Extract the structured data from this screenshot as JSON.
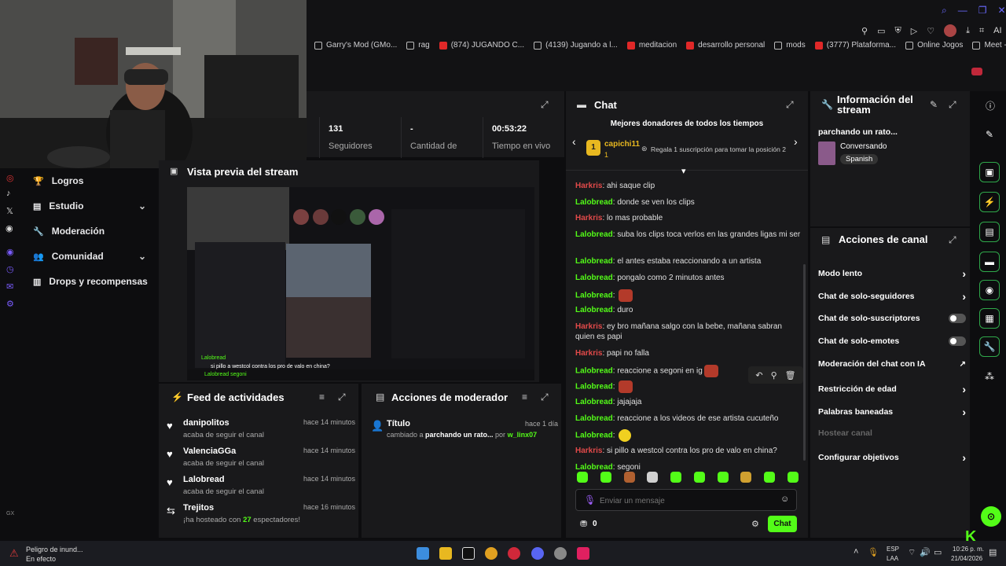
{
  "bookmarks": [
    {
      "label": "Garry's Mod (GMo...",
      "icon": "doc"
    },
    {
      "label": "rag",
      "icon": "doc"
    },
    {
      "label": "(874) JUGANDO C...",
      "icon": "youtube"
    },
    {
      "label": "(4139) Jugando a l...",
      "icon": "doc"
    },
    {
      "label": "meditacion",
      "icon": "youtube"
    },
    {
      "label": "desarrollo personal",
      "icon": "youtube"
    },
    {
      "label": "mods",
      "icon": "doc"
    },
    {
      "label": "(3777) Plataforma...",
      "icon": "youtube"
    },
    {
      "label": "Online Jogos",
      "icon": "globe"
    },
    {
      "label": "Meet - bmi-cosq-...",
      "icon": "meet"
    }
  ],
  "toolbar": {
    "ai_label": "AI"
  },
  "left_nav": [
    {
      "label": "Logros",
      "icon": "trophy-icon",
      "chevron": false
    },
    {
      "label": "Estudio",
      "icon": "studio-icon",
      "chevron": true
    },
    {
      "label": "Moderación",
      "icon": "wrench-icon",
      "chevron": false
    },
    {
      "label": "Comunidad",
      "icon": "community-icon",
      "chevron": true
    },
    {
      "label": "Drops y recompensas",
      "icon": "drops-icon",
      "chevron": false
    }
  ],
  "left_rail": {
    "gx_label": "GX"
  },
  "stats": [
    {
      "value": "131",
      "label": "Seguidores"
    },
    {
      "value": "-",
      "label": "Cantidad de"
    },
    {
      "value": "00:53:22",
      "label": "Tiempo en vivo"
    }
  ],
  "preview": {
    "title": "Vista previa del stream"
  },
  "preview_overlay": {
    "line1": "Lalobread",
    "line2": "si pillo a westcol contra los pro de valo en china?",
    "line3": "Lalobread segoni"
  },
  "feed": {
    "title": "Feed de actividades",
    "items": [
      {
        "name": "danipolitos",
        "sub": "acaba de seguir el canal",
        "time": "hace 14 minutos",
        "icon": "heart-icon"
      },
      {
        "name": "ValenciaGGa",
        "sub": "acaba de seguir el canal",
        "time": "hace 14 minutos",
        "icon": "heart-icon"
      },
      {
        "name": "Lalobread",
        "sub": "acaba de seguir el canal",
        "time": "hace 14 minutos",
        "icon": "heart-icon"
      },
      {
        "name": "Trejitos",
        "sub_pre": "¡ha hosteado con ",
        "sub_num": "27",
        "sub_post": " espectadores!",
        "time": "hace 16 minutos",
        "icon": "host-icon"
      }
    ]
  },
  "mod_actions": {
    "title": "Acciones de moderador",
    "item": {
      "label": "Título",
      "time": "hace 1 día",
      "pre": "cambiado a ",
      "value": "parchando un rato...",
      "by_pre": " por ",
      "by": "w_linx07"
    }
  },
  "chat": {
    "title": "Chat",
    "donors_title": "Mejores donadores de todos los tiempos",
    "top_donor": {
      "rank": "1",
      "name": "capichi11",
      "amount": "1"
    },
    "donor_cta": "Regala 1 suscripción para tomar la posición 2",
    "messages": [
      {
        "user": "Harkris",
        "color": "red",
        "text": "ahi saque clip"
      },
      {
        "user": "Lalobread",
        "color": "green",
        "text": "donde se ven los clips"
      },
      {
        "user": "Harkris",
        "color": "red",
        "text": "lo mas probable"
      },
      {
        "user": "Lalobread",
        "color": "green",
        "text": "suba los clips toca verlos en las grandes ligas mi ser"
      },
      {
        "user": "Lalobread",
        "color": "green",
        "text": "el antes estaba reaccionando a un artista"
      },
      {
        "user": "Lalobread",
        "color": "green",
        "text": "pongalo como 2 minutos antes"
      },
      {
        "user": "Lalobread",
        "color": "green",
        "text": "",
        "emote": "red"
      },
      {
        "user": "Lalobread",
        "color": "green",
        "text": "duro"
      },
      {
        "user": "Harkris",
        "color": "red",
        "text": "ey bro mañana salgo con la bebe, mañana sabran quien es papi"
      },
      {
        "user": "Harkris",
        "color": "red",
        "text": "papi no falla"
      },
      {
        "user": "Lalobread",
        "color": "green",
        "text": "reaccione a segoni en ig",
        "emote": "red"
      },
      {
        "user": "Lalobread",
        "color": "green",
        "text": "",
        "emote": "red"
      },
      {
        "user": "Lalobread",
        "color": "green",
        "text": "jajajaja"
      },
      {
        "user": "Lalobread",
        "color": "green",
        "text": "reaccione a los videos de ese artista cucuteño"
      },
      {
        "user": "Lalobread",
        "color": "green",
        "text": "",
        "emote": "yellow"
      },
      {
        "user": "Harkris",
        "color": "red",
        "text": "si pillo a westcol contra los pro de valo en china?"
      },
      {
        "user": "Lalobread",
        "color": "green",
        "text": "segoni"
      }
    ],
    "input_placeholder": "Enviar un mensaje",
    "points": "0",
    "send_label": "Chat"
  },
  "stream_info": {
    "title": "Información del stream",
    "stream_title": "parchando un rato...",
    "category": "Conversando",
    "language": "Spanish"
  },
  "channel_actions": {
    "title": "Acciones de canal",
    "items": [
      {
        "label": "Modo lento",
        "control": "chevron"
      },
      {
        "label": "Chat de solo-seguidores",
        "control": "chevron"
      },
      {
        "label": "Chat de solo-suscriptores",
        "control": "toggle"
      },
      {
        "label": "Chat de solo-emotes",
        "control": "toggle"
      },
      {
        "label": "Moderación del chat con IA",
        "control": "external"
      },
      {
        "label": "Restricción de edad",
        "control": "chevron"
      },
      {
        "label": "Palabras baneadas",
        "control": "chevron"
      },
      {
        "label": "Hostear canal",
        "control": "none",
        "disabled": true
      },
      {
        "label": "Configurar objetivos",
        "control": "chevron"
      }
    ]
  },
  "taskbar": {
    "weather_title": "Peligro de inund...",
    "weather_sub": "En efecto",
    "lang_line1": "ESP",
    "lang_line2": "LAA",
    "time": "10:26 p. m.",
    "date": "21/04/2026"
  },
  "colors": {
    "accent": "#53fc18",
    "panel": "#19191b",
    "background": "#0d0d0f",
    "red_user": "#e24a4a"
  }
}
